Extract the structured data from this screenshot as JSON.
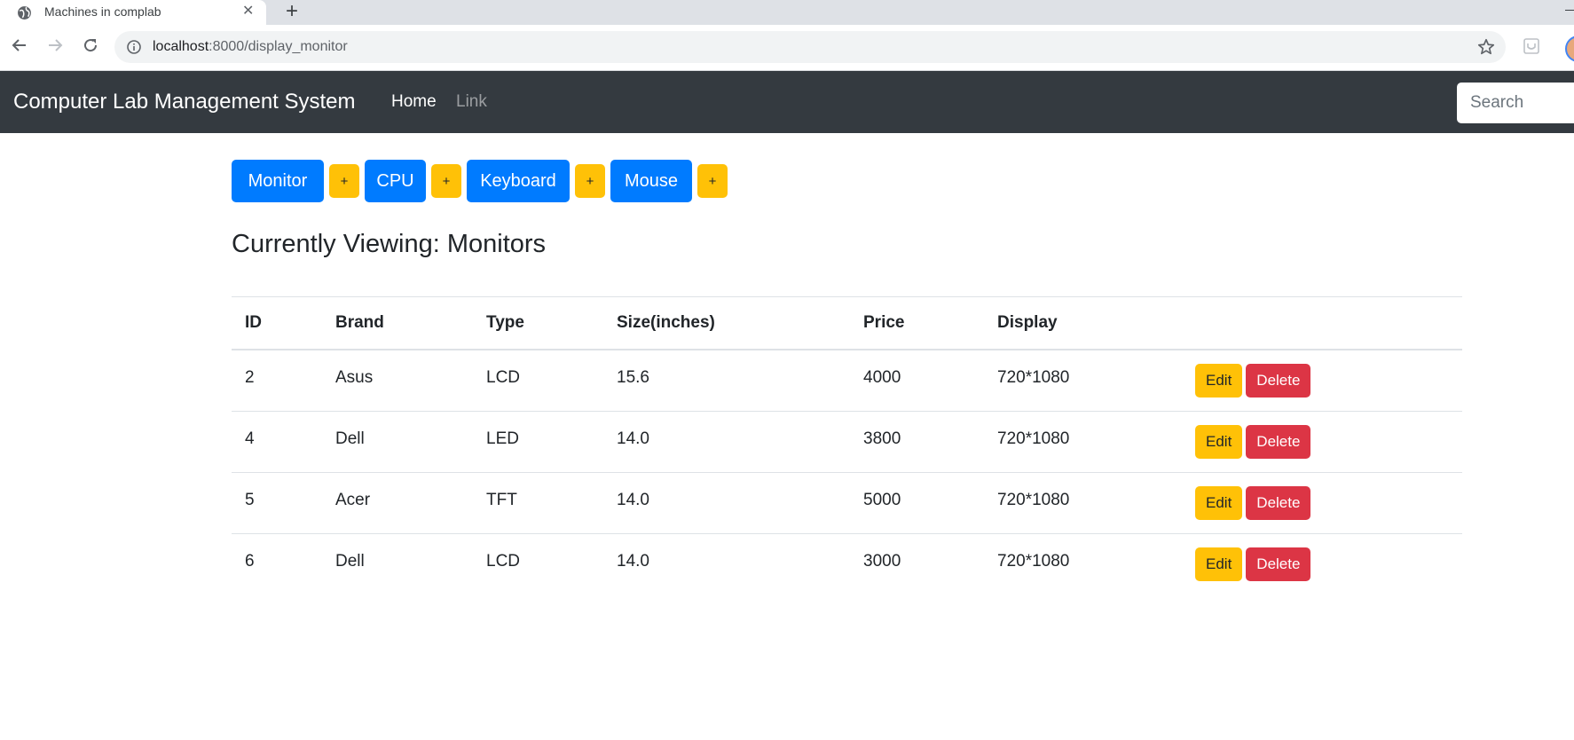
{
  "browser": {
    "tab_title": "Machines in complab",
    "url_host": "localhost",
    "url_path": ":8000/display_monitor"
  },
  "navbar": {
    "brand": "Computer Lab Management System",
    "links": [
      "Home",
      "Link"
    ],
    "search_placeholder": "Search"
  },
  "categories": [
    {
      "label": "Monitor",
      "add_label": "+"
    },
    {
      "label": "CPU",
      "add_label": "+"
    },
    {
      "label": "Keyboard",
      "add_label": "+"
    },
    {
      "label": "Mouse",
      "add_label": "+"
    }
  ],
  "heading": "Currently Viewing: Monitors",
  "table": {
    "headers": [
      "ID",
      "Brand",
      "Type",
      "Size(inches)",
      "Price",
      "Display"
    ],
    "rows": [
      [
        "2",
        "Asus",
        "LCD",
        "15.6",
        "4000",
        "720*1080"
      ],
      [
        "4",
        "Dell",
        "LED",
        "14.0",
        "3800",
        "720*1080"
      ],
      [
        "5",
        "Acer",
        "TFT",
        "14.0",
        "5000",
        "720*1080"
      ],
      [
        "6",
        "Dell",
        "LCD",
        "14.0",
        "3000",
        "720*1080"
      ]
    ],
    "edit_label": "Edit",
    "delete_label": "Delete"
  },
  "colors": {
    "primary": "#007bff",
    "warning": "#ffc107",
    "danger": "#dc3545",
    "navbar": "#343a40"
  },
  "icons": [
    "globe-icon",
    "close-icon",
    "plus-icon",
    "back-arrow-icon",
    "forward-arrow-icon",
    "reload-icon",
    "info-icon",
    "star-icon",
    "extension-icon",
    "profile-icon"
  ]
}
